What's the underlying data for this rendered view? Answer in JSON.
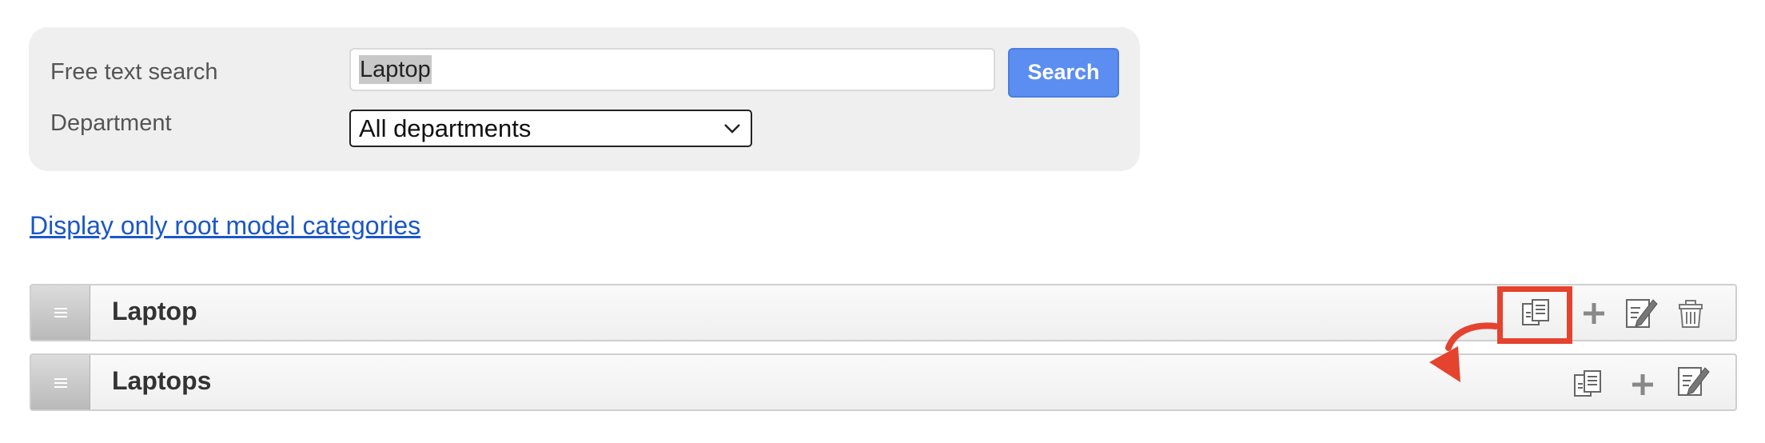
{
  "search": {
    "free_text_label": "Free text search",
    "free_text_value": "Laptop",
    "search_button_label": "Search",
    "department_label": "Department",
    "department_selected": "All departments"
  },
  "links": {
    "root_categories": "Display only root model categories"
  },
  "categories": [
    {
      "title": "Laptop",
      "actions": [
        "copy-icon",
        "plus-icon",
        "edit-icon",
        "trash-icon"
      ]
    },
    {
      "title": "Laptops",
      "actions": [
        "copy-icon",
        "plus-icon",
        "edit-icon"
      ]
    }
  ],
  "colors": {
    "accent": "#5b8ef0",
    "link": "#1a57c7",
    "annotation": "#e5432e"
  }
}
